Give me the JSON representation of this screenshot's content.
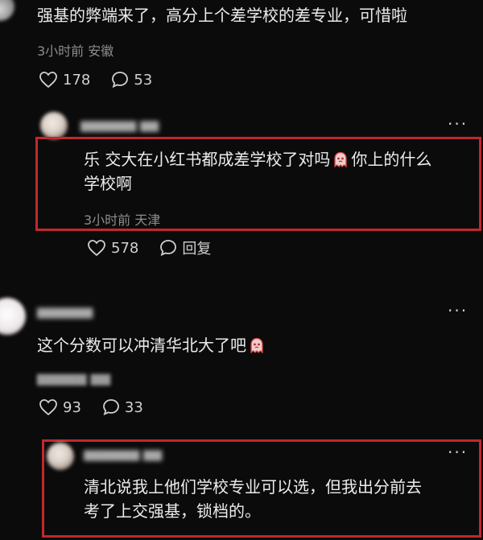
{
  "comments": [
    {
      "text": "强基的弊端来了，高分上个差学校的差专业，可惜啦",
      "time": "3小时前",
      "location": "安徽",
      "likes": "178",
      "replies": "53"
    },
    {
      "text_line1_a": "乐 交大在小红书都成差学校了对吗",
      "text_line1_b": "你上的什么",
      "text_line2": "学校啊",
      "time": "3小时前",
      "location": "天津",
      "likes": "578",
      "reply_label": "回复"
    },
    {
      "text": "这个分数可以冲清华北大了吧",
      "likes": "93",
      "replies": "33"
    },
    {
      "text_line1": "清北说我上他们学校专业可以选，但我出分前去",
      "text_line2": "考了上交强基，锁档的。"
    }
  ],
  "more_glyph": "···",
  "colors": {
    "highlight": "#c0282d",
    "background": "#0b0b0b"
  },
  "icons": [
    "heart-icon",
    "comment-icon",
    "ghost-emoji-icon",
    "more-icon"
  ]
}
